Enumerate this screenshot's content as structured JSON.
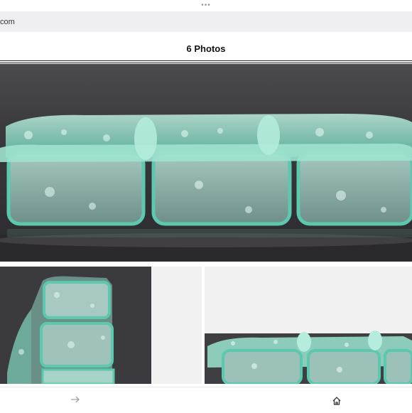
{
  "browser": {
    "menu_dots": "•••",
    "url_fragment": "com"
  },
  "sheet": {
    "title": "6 Photos"
  },
  "photos": [
    {
      "alt": "glass three-compartment dish, front view"
    },
    {
      "alt": "glass dish, angled view"
    },
    {
      "alt": "empty tile"
    },
    {
      "alt": "glass dish, low front view"
    }
  ],
  "bottom_nav": {
    "forward_icon": "arrow-right-icon",
    "home_icon": "home-icon"
  },
  "colors": {
    "glass": "#8fd8c6",
    "glass_edge": "#4fc0a6",
    "backdrop": "#3c3b3f"
  }
}
